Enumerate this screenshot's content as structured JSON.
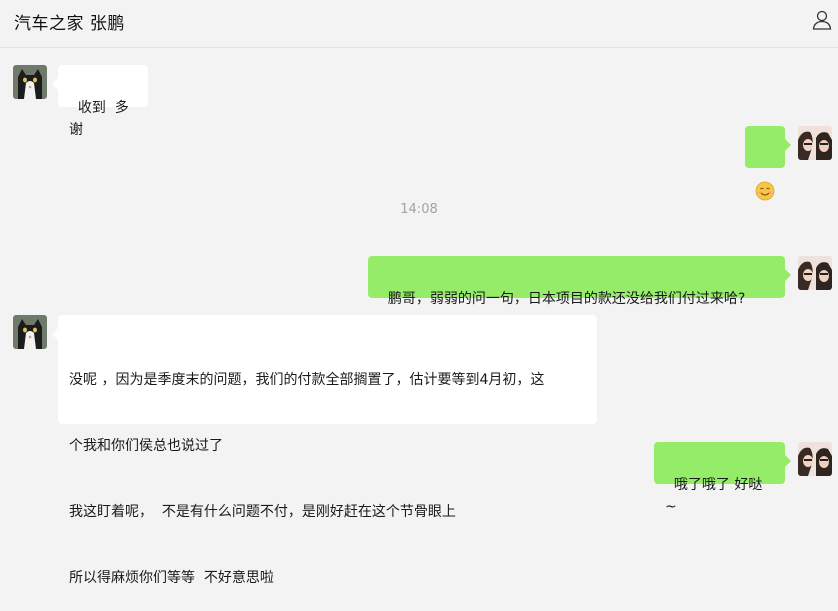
{
  "header": {
    "title": "汽车之家 张鹏",
    "profile_icon": "person-outline-icon"
  },
  "contact_avatar": "cat-avatar",
  "self_avatar": "selfie-avatar",
  "messages": [
    {
      "direction": "in",
      "text": "收到  多谢"
    },
    {
      "direction": "out",
      "emoji": "smiling-face-emoji"
    },
    {
      "direction": "out",
      "text": "鹏哥，弱弱的问一句，日本项目的款还没给我们付过来哈?"
    },
    {
      "direction": "in",
      "lines": [
        "没呢 ，因为是季度末的问题，我们的付款全部搁置了，估计要等到4月初，这",
        "个我和你们侯总也说过了",
        "我这盯着呢，  不是有什么问题不付，是刚好赶在这个节骨眼上",
        "所以得麻烦你们等等  不好意思啦"
      ]
    },
    {
      "direction": "out",
      "text": "哦了哦了 好哒~"
    }
  ],
  "timestamp": "14:08",
  "colors": {
    "background": "#f3f3f3",
    "incoming_bubble": "#ffffff",
    "outgoing_bubble": "#95ec69",
    "timestamp_text": "#a3a3a3"
  }
}
